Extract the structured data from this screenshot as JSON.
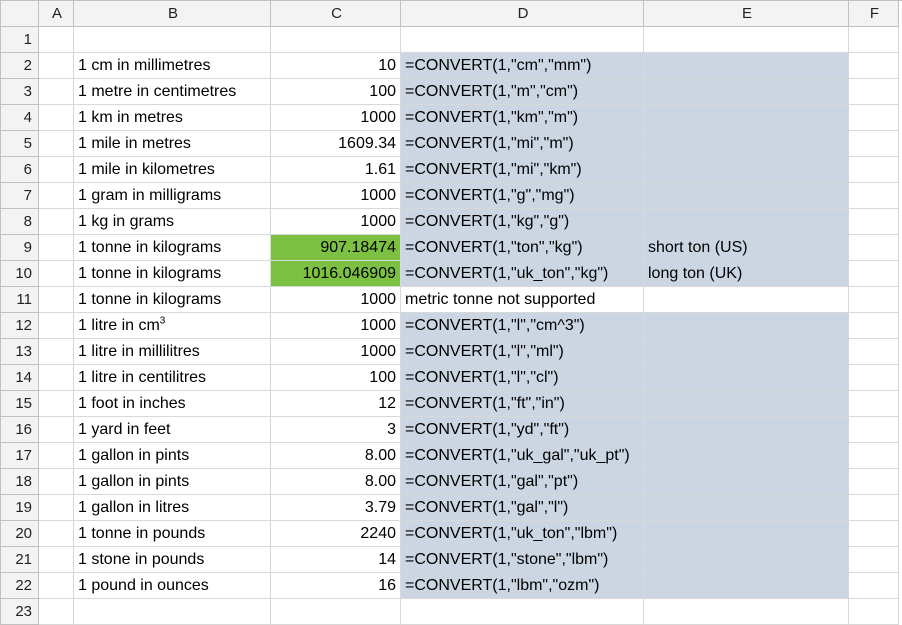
{
  "columns": [
    "A",
    "B",
    "C",
    "D",
    "E",
    "F"
  ],
  "row_count": 23,
  "rows": [
    {
      "r": 1,
      "A": "",
      "B": "",
      "C": "",
      "D": "",
      "E": "",
      "F": ""
    },
    {
      "r": 2,
      "A": "",
      "B": "1 cm in millimetres",
      "C": "10",
      "D": "=CONVERT(1,\"cm\",\"mm\")",
      "E": "",
      "F": "",
      "shadeD": true,
      "shadeE": true
    },
    {
      "r": 3,
      "A": "",
      "B": "1 metre in centimetres",
      "C": "100",
      "D": "=CONVERT(1,\"m\",\"cm\")",
      "E": "",
      "F": "",
      "shadeD": true,
      "shadeE": true
    },
    {
      "r": 4,
      "A": "",
      "B": "1 km in metres",
      "C": "1000",
      "D": "=CONVERT(1,\"km\",\"m\")",
      "E": "",
      "F": "",
      "shadeD": true,
      "shadeE": true
    },
    {
      "r": 5,
      "A": "",
      "B": "1 mile in metres",
      "C": "1609.34",
      "D": "=CONVERT(1,\"mi\",\"m\")",
      "E": "",
      "F": "",
      "shadeD": true,
      "shadeE": true
    },
    {
      "r": 6,
      "A": "",
      "B": "1 mile in kilometres",
      "C": "1.61",
      "D": "=CONVERT(1,\"mi\",\"km\")",
      "E": "",
      "F": "",
      "shadeD": true,
      "shadeE": true
    },
    {
      "r": 7,
      "A": "",
      "B": "1 gram in milligrams",
      "C": "1000",
      "D": "=CONVERT(1,\"g\",\"mg\")",
      "E": "",
      "F": "",
      "shadeD": true,
      "shadeE": true
    },
    {
      "r": 8,
      "A": "",
      "B": "1 kg in grams",
      "C": "1000",
      "D": "=CONVERT(1,\"kg\",\"g\")",
      "E": "",
      "F": "",
      "shadeD": true,
      "shadeE": true
    },
    {
      "r": 9,
      "A": "",
      "B": "1 tonne in kilograms",
      "C": "907.18474",
      "D": "=CONVERT(1,\"ton\",\"kg\")",
      "E": "short ton (US)",
      "F": "",
      "shadeD": true,
      "shadeE": true,
      "greenC": true
    },
    {
      "r": 10,
      "A": "",
      "B": "1 tonne in kilograms",
      "C": "1016.046909",
      "D": "=CONVERT(1,\"uk_ton\",\"kg\")",
      "E": "long ton (UK)",
      "F": "",
      "shadeD": true,
      "shadeE": true,
      "greenC": true
    },
    {
      "r": 11,
      "A": "",
      "B": "1 tonne in kilograms",
      "C": "1000",
      "D": "metric tonne not supported",
      "E": "",
      "F": ""
    },
    {
      "r": 12,
      "A": "",
      "B": "1 litre in cm",
      "B_sup": "3",
      "C": "1000",
      "D": "=CONVERT(1,\"l\",\"cm^3\")",
      "E": "",
      "F": "",
      "shadeD": true,
      "shadeE": true
    },
    {
      "r": 13,
      "A": "",
      "B": "1 litre in millilitres",
      "C": "1000",
      "D": "=CONVERT(1,\"l\",\"ml\")",
      "E": "",
      "F": "",
      "shadeD": true,
      "shadeE": true
    },
    {
      "r": 14,
      "A": "",
      "B": "1 litre in centilitres",
      "C": "100",
      "D": "=CONVERT(1,\"l\",\"cl\")",
      "E": "",
      "F": "",
      "shadeD": true,
      "shadeE": true
    },
    {
      "r": 15,
      "A": "",
      "B": "1 foot in inches",
      "C": "12",
      "D": "=CONVERT(1,\"ft\",\"in\")",
      "E": "",
      "F": "",
      "shadeD": true,
      "shadeE": true
    },
    {
      "r": 16,
      "A": "",
      "B": "1 yard in feet",
      "C": "3",
      "D": "=CONVERT(1,\"yd\",\"ft\")",
      "E": "",
      "F": "",
      "shadeD": true,
      "shadeE": true
    },
    {
      "r": 17,
      "A": "",
      "B": "1 gallon in pints",
      "C": "8.00",
      "D": "=CONVERT(1,\"uk_gal\",\"uk_pt\")",
      "E": "",
      "F": "",
      "shadeD": true,
      "shadeE": true
    },
    {
      "r": 18,
      "A": "",
      "B": "1 gallon in pints",
      "C": "8.00",
      "D": "=CONVERT(1,\"gal\",\"pt\")",
      "E": "",
      "F": "",
      "shadeD": true,
      "shadeE": true
    },
    {
      "r": 19,
      "A": "",
      "B": "1 gallon in litres",
      "C": "3.79",
      "D": "=CONVERT(1,\"gal\",\"l\")",
      "E": "",
      "F": "",
      "shadeD": true,
      "shadeE": true
    },
    {
      "r": 20,
      "A": "",
      "B": "1 tonne in pounds",
      "C": "2240",
      "D": "=CONVERT(1,\"uk_ton\",\"lbm\")",
      "E": "",
      "F": "",
      "shadeD": true,
      "shadeE": true
    },
    {
      "r": 21,
      "A": "",
      "B": "1 stone in pounds",
      "C": "14",
      "D": "=CONVERT(1,\"stone\",\"lbm\")",
      "E": "",
      "F": "",
      "shadeD": true,
      "shadeE": true
    },
    {
      "r": 22,
      "A": "",
      "B": "1 pound in ounces",
      "C": "16",
      "D": "=CONVERT(1,\"lbm\",\"ozm\")",
      "E": "",
      "F": "",
      "shadeD": true,
      "shadeE": true
    },
    {
      "r": 23,
      "A": "",
      "B": "",
      "C": "",
      "D": "",
      "E": "",
      "F": ""
    }
  ]
}
